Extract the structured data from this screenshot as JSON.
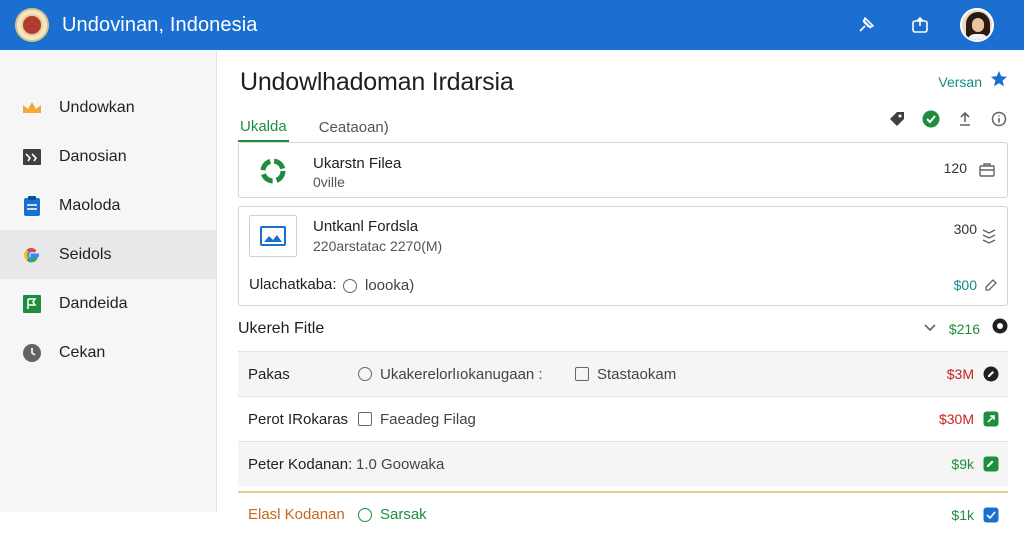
{
  "app": {
    "title": "Undovinan, Indonesia",
    "accent": "#1a6fd1"
  },
  "topbar": {
    "icons": [
      "pin-icon",
      "share-icon"
    ]
  },
  "sidebar": {
    "items": [
      {
        "label": "Undowkan",
        "icon": "crown-icon",
        "color": "#f2a93b"
      },
      {
        "label": "Danosian",
        "icon": "image-icon",
        "color": "#3c4043"
      },
      {
        "label": "Maoloda",
        "icon": "clipboard-icon",
        "color": "#1a6fd1"
      },
      {
        "label": "Seidols",
        "icon": "google-icon",
        "active": true
      },
      {
        "label": "Dandeida",
        "icon": "flag-icon",
        "color": "#1e8e3e"
      },
      {
        "label": "Cekan",
        "icon": "clock-icon",
        "color": "#5f6368"
      }
    ]
  },
  "main": {
    "title": "Undowlhadoman Irdarsia",
    "version_label": "Versan",
    "tabs": [
      {
        "label": "Ukalda",
        "active": true
      },
      {
        "label": "Ceataoan)"
      }
    ],
    "tab_icons": [
      "tag-icon",
      "check-circle-icon",
      "upload-icon",
      "info-icon"
    ],
    "files": [
      {
        "name": "Ukarstn Filea",
        "sub": "0ville",
        "count": "120",
        "icon": "recycle-icon"
      },
      {
        "name": "Untkanl Fordsla",
        "sub": "220arstatac 2270(M)",
        "count": "300",
        "icon": "folder-image-icon",
        "footer_label": "Ulachatkaba:",
        "footer_option": "loooka)",
        "footer_amount": "$00"
      }
    ],
    "section": {
      "title": "Ukereh Fitle",
      "total": "$216"
    },
    "rows": [
      {
        "label": "Pakas",
        "opt1": "Ukakerelorlıokanugaan :",
        "opt1_type": "radio",
        "opt2": "Stastaokam",
        "opt2_type": "check",
        "amount": "$3M",
        "amount_color": "#c5221f",
        "badge_color": "#202124"
      },
      {
        "label": "Perot IRokaras",
        "opt1": "Faeadeg Filag",
        "opt1_type": "check",
        "amount": "$30M",
        "amount_color": "#c5221f",
        "badge_color": "#1e8e3e"
      },
      {
        "label": "Peter Kodanan:",
        "opt1": "1.0  Goowaka",
        "opt1_type": "none",
        "amount": "$9k",
        "amount_color": "#1e8e3e",
        "badge_color": "#1e8e3e"
      },
      {
        "label": "Elasl Kodanan",
        "opt1": "Sarsak",
        "opt1_type": "radio",
        "amount": "$1k",
        "amount_color": "#1e8e3e",
        "badge_color": "#1a6fd1"
      }
    ]
  }
}
